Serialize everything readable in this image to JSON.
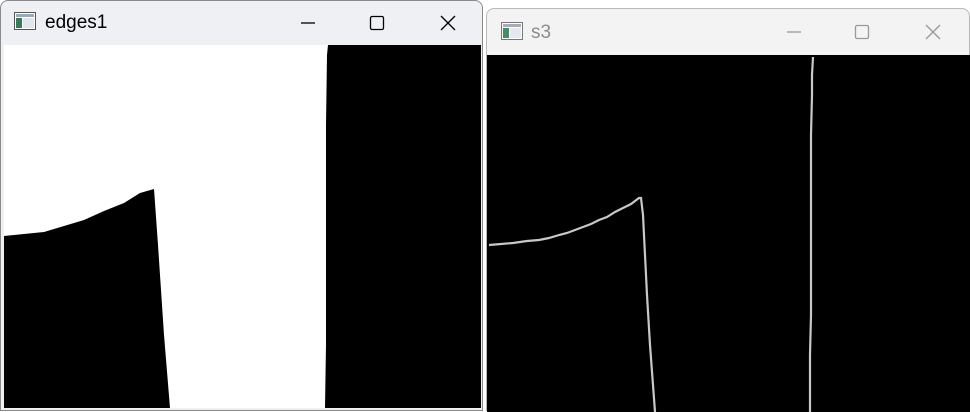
{
  "windows": [
    {
      "title": "edges1",
      "active": true
    },
    {
      "title": "s3",
      "active": false
    }
  ],
  "controls": {
    "minimize": "minimize",
    "maximize": "maximize",
    "close": "close"
  },
  "colors": {
    "active_title": "#000000",
    "inactive_title": "#8c8c8c",
    "image_bg": "#000000",
    "image_fg": "#ffffff",
    "edge_line": "#c0c0c0"
  }
}
